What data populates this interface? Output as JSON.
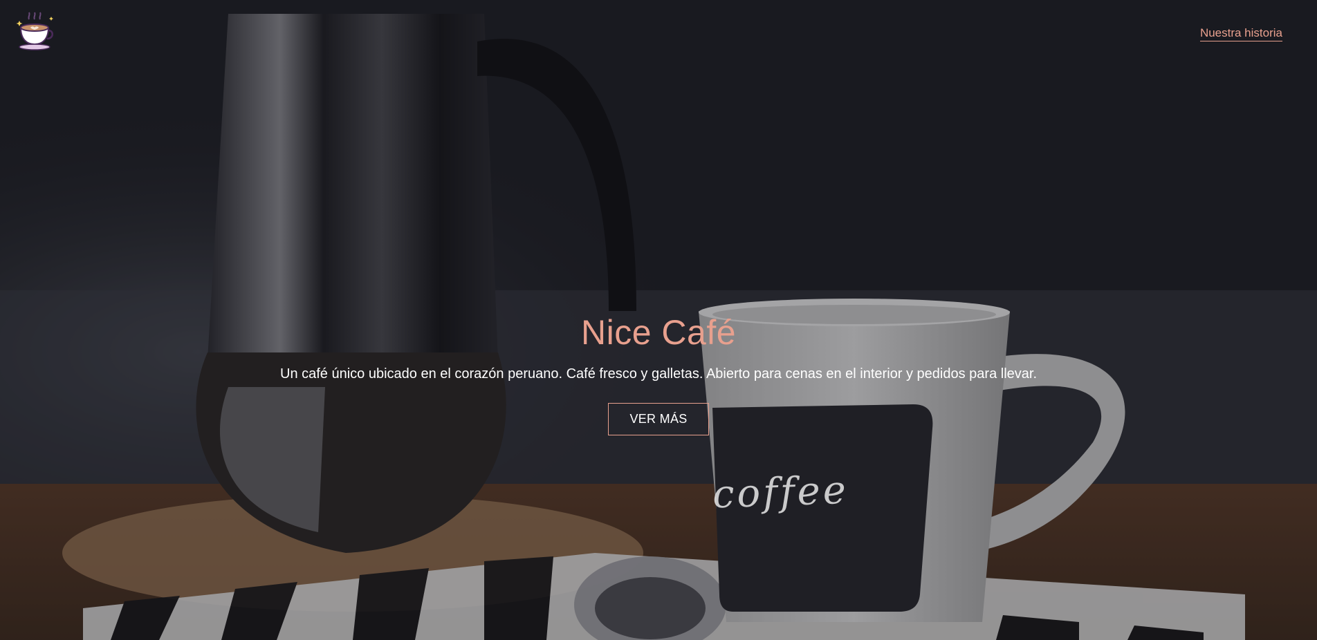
{
  "header": {
    "logo_icon": "coffee-cup-logo-icon",
    "nav_link": "Nuestra historia"
  },
  "hero": {
    "title": "Nice Café",
    "subtitle": "Un café único ubicado en el corazón peruano. Café fresco y galletas. Abierto para cenas en el interior y pedidos para llevar.",
    "cta_label": "VER MÁS",
    "mug_text": "coffee"
  },
  "colors": {
    "accent": "#e8a08e",
    "text_light": "#ffffff",
    "background_dark": "#1b1c22"
  }
}
